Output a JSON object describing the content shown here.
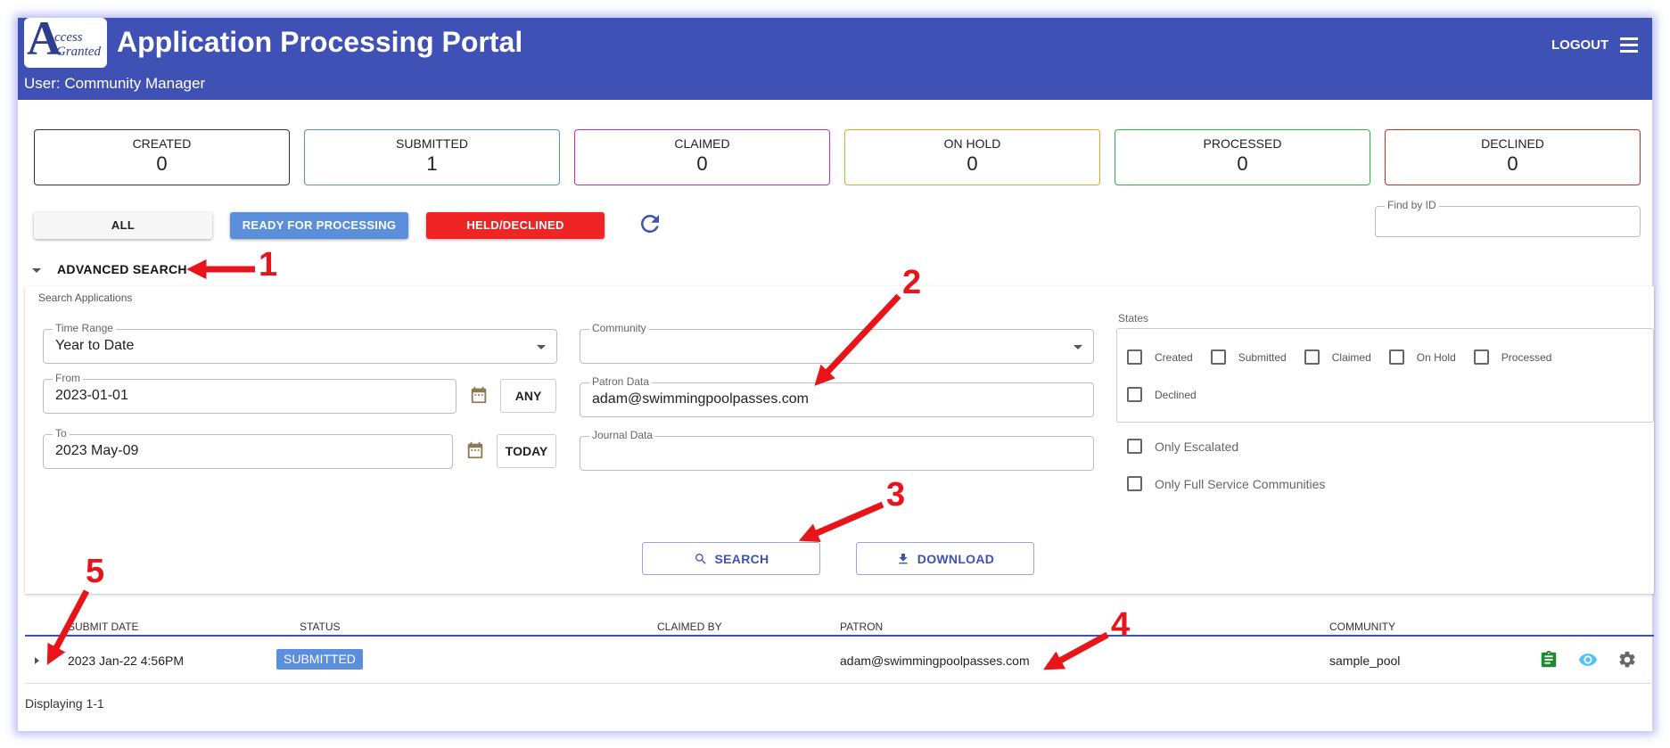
{
  "header": {
    "logo_letter": "A",
    "logo_word1": "ccess",
    "logo_word2": "Granted",
    "title": "Application Processing Portal",
    "user": "User: Community Manager",
    "logout_label": "LOGOUT"
  },
  "stats": [
    {
      "label": "CREATED",
      "value": "0",
      "color": "#333333"
    },
    {
      "label": "SUBMITTED",
      "value": "1",
      "color": "#5b8fdc"
    },
    {
      "label": "CLAIMED",
      "value": "0",
      "color": "#c12fc1"
    },
    {
      "label": "ON HOLD",
      "value": "0",
      "color": "#f0a030"
    },
    {
      "label": "PROCESSED",
      "value": "0",
      "color": "#2fb14a"
    },
    {
      "label": "DECLINED",
      "value": "0",
      "color": "#e52525"
    }
  ],
  "filters": {
    "all": "ALL",
    "ready": "READY FOR PROCESSING",
    "held": "HELD/DECLINED",
    "find_by_id_label": "Find by ID",
    "find_by_id_value": ""
  },
  "advanced": {
    "label": "ADVANCED SEARCH",
    "panel_title": "Search Applications",
    "time_range_label": "Time Range",
    "time_range_value": "Year to Date",
    "from_label": "From",
    "from_value": "2023-01-01",
    "any_label": "ANY",
    "to_label": "To",
    "to_value": "2023 May-09",
    "today_label": "TODAY",
    "community_label": "Community",
    "community_value": "",
    "patron_label": "Patron Data",
    "patron_value": "adam@swimmingpoolpasses.com",
    "journal_label": "Journal Data",
    "journal_value": "",
    "states_label": "States",
    "states": [
      "Created",
      "Submitted",
      "Claimed",
      "On Hold",
      "Processed",
      "Declined"
    ],
    "only_escalated": "Only Escalated",
    "only_full_service": "Only Full Service Communities",
    "search_label": "SEARCH",
    "download_label": "DOWNLOAD"
  },
  "table": {
    "columns": [
      "SUBMIT DATE",
      "STATUS",
      "CLAIMED BY",
      "PATRON",
      "COMMUNITY"
    ],
    "rows": [
      {
        "submit_date": "2023 Jan-22 4:56PM",
        "status": "SUBMITTED",
        "claimed_by": "",
        "patron": "adam@swimmingpoolpasses.com",
        "community": "sample_pool"
      }
    ],
    "footer": "Displaying 1-1"
  },
  "annotations": [
    "1",
    "2",
    "3",
    "4",
    "5"
  ],
  "colors": {
    "header_bg": "#3f51b5",
    "accent": "#3f51b5",
    "annotation_red": "#e8141a",
    "ready_blue": "#5b8fdc",
    "held_red": "#ef2525"
  }
}
